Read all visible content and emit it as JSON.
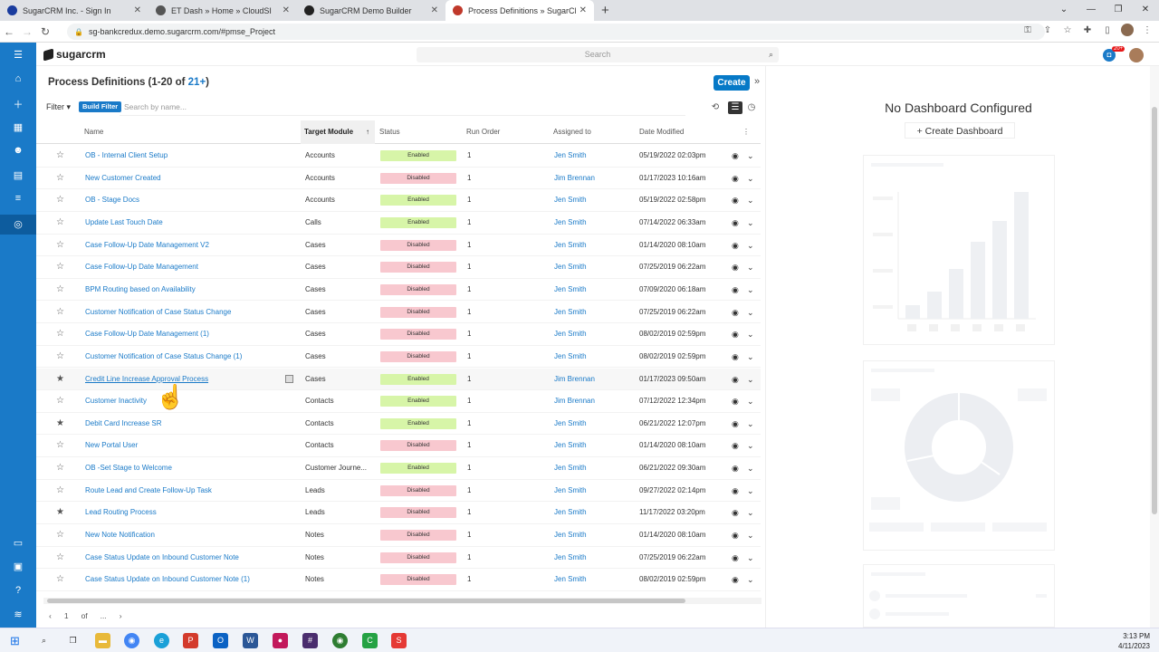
{
  "browser": {
    "tabs": [
      {
        "title": "SugarCRM Inc. - Sign In",
        "color": "#1a3c9e"
      },
      {
        "title": "ET Dash » Home » CloudSI",
        "color": "#555555"
      },
      {
        "title": "SugarCRM Demo Builder",
        "color": "#222222"
      },
      {
        "title": "Process Definitions » SugarCRM",
        "color": "#c0392b"
      }
    ],
    "new_tab": "+",
    "url": "sg-bankcredux.demo.sugarcrm.com/#pmse_Project"
  },
  "app": {
    "logo": "sugarcrm",
    "search_placeholder": "Search",
    "notif_badge": "20+"
  },
  "list": {
    "title": "Process Definitions (1-20 of ",
    "count": "21+",
    "title_end": ")",
    "create_label": "Create",
    "filter_label": "Filter",
    "build_filter": "Build Filter",
    "search_placeholder": "Search by name...",
    "columns": [
      "Name",
      "Target Module",
      "Status",
      "Run Order",
      "Assigned to",
      "Date Modified"
    ],
    "rows": [
      {
        "name": "OB - Internal Client Setup",
        "module": "Accounts",
        "status": "Enabled",
        "order": "1",
        "user": "Jen Smith",
        "date": "05/19/2022 02:03pm",
        "star": false
      },
      {
        "name": "New Customer Created",
        "module": "Accounts",
        "status": "Disabled",
        "order": "1",
        "user": "Jim Brennan",
        "date": "01/17/2023 10:16am",
        "star": false
      },
      {
        "name": "OB - Stage Docs",
        "module": "Accounts",
        "status": "Enabled",
        "order": "1",
        "user": "Jen Smith",
        "date": "05/19/2022 02:58pm",
        "star": false
      },
      {
        "name": "Update Last Touch Date",
        "module": "Calls",
        "status": "Enabled",
        "order": "1",
        "user": "Jen Smith",
        "date": "07/14/2022 06:33am",
        "star": false
      },
      {
        "name": "Case Follow-Up Date Management V2",
        "module": "Cases",
        "status": "Disabled",
        "order": "1",
        "user": "Jen Smith",
        "date": "01/14/2020 08:10am",
        "star": false
      },
      {
        "name": "Case Follow-Up Date Management",
        "module": "Cases",
        "status": "Disabled",
        "order": "1",
        "user": "Jen Smith",
        "date": "07/25/2019 06:22am",
        "star": false
      },
      {
        "name": "BPM Routing based on Availability",
        "module": "Cases",
        "status": "Disabled",
        "order": "1",
        "user": "Jen Smith",
        "date": "07/09/2020 06:18am",
        "star": false
      },
      {
        "name": "Customer Notification of Case Status Change",
        "module": "Cases",
        "status": "Disabled",
        "order": "1",
        "user": "Jen Smith",
        "date": "07/25/2019 06:22am",
        "star": false
      },
      {
        "name": "Case Follow-Up Date Management (1)",
        "module": "Cases",
        "status": "Disabled",
        "order": "1",
        "user": "Jen Smith",
        "date": "08/02/2019 02:59pm",
        "star": false
      },
      {
        "name": "Customer Notification of Case Status Change (1)",
        "module": "Cases",
        "status": "Disabled",
        "order": "1",
        "user": "Jen Smith",
        "date": "08/02/2019 02:59pm",
        "star": false
      },
      {
        "name": "Credit Line Increase Approval Process",
        "module": "Cases",
        "status": "Enabled",
        "order": "1",
        "user": "Jim Brennan",
        "date": "01/17/2023 09:50am",
        "star": true
      },
      {
        "name": "Customer Inactivity",
        "module": "Contacts",
        "status": "Enabled",
        "order": "1",
        "user": "Jim Brennan",
        "date": "07/12/2022 12:34pm",
        "star": false
      },
      {
        "name": "Debit Card Increase SR",
        "module": "Contacts",
        "status": "Enabled",
        "order": "1",
        "user": "Jen Smith",
        "date": "06/21/2022 12:07pm",
        "star": true
      },
      {
        "name": "New Portal User",
        "module": "Contacts",
        "status": "Disabled",
        "order": "1",
        "user": "Jen Smith",
        "date": "01/14/2020 08:10am",
        "star": false
      },
      {
        "name": "OB -Set Stage to Welcome",
        "module": "Customer Journe...",
        "status": "Enabled",
        "order": "1",
        "user": "Jen Smith",
        "date": "06/21/2022 09:30am",
        "star": false
      },
      {
        "name": "Route Lead and Create Follow-Up Task",
        "module": "Leads",
        "status": "Disabled",
        "order": "1",
        "user": "Jen Smith",
        "date": "09/27/2022 02:14pm",
        "star": false
      },
      {
        "name": "Lead Routing Process",
        "module": "Leads",
        "status": "Disabled",
        "order": "1",
        "user": "Jen Smith",
        "date": "11/17/2022 03:20pm",
        "star": true
      },
      {
        "name": "New Note Notification",
        "module": "Notes",
        "status": "Disabled",
        "order": "1",
        "user": "Jen Smith",
        "date": "01/14/2020 08:10am",
        "star": false
      },
      {
        "name": "Case Status Update on Inbound Customer Note",
        "module": "Notes",
        "status": "Disabled",
        "order": "1",
        "user": "Jen Smith",
        "date": "07/25/2019 06:22am",
        "star": false
      },
      {
        "name": "Case Status Update on Inbound Customer Note (1)",
        "module": "Notes",
        "status": "Disabled",
        "order": "1",
        "user": "Jen Smith",
        "date": "08/02/2019 02:59pm",
        "star": false
      }
    ],
    "pager": {
      "page": "1",
      "of": "of",
      "more": "..."
    }
  },
  "dashboard": {
    "title": "No Dashboard Configured",
    "create_label": "Create Dashboard"
  },
  "taskbar": {
    "time": "3:13 PM",
    "date": "4/11/2023"
  }
}
